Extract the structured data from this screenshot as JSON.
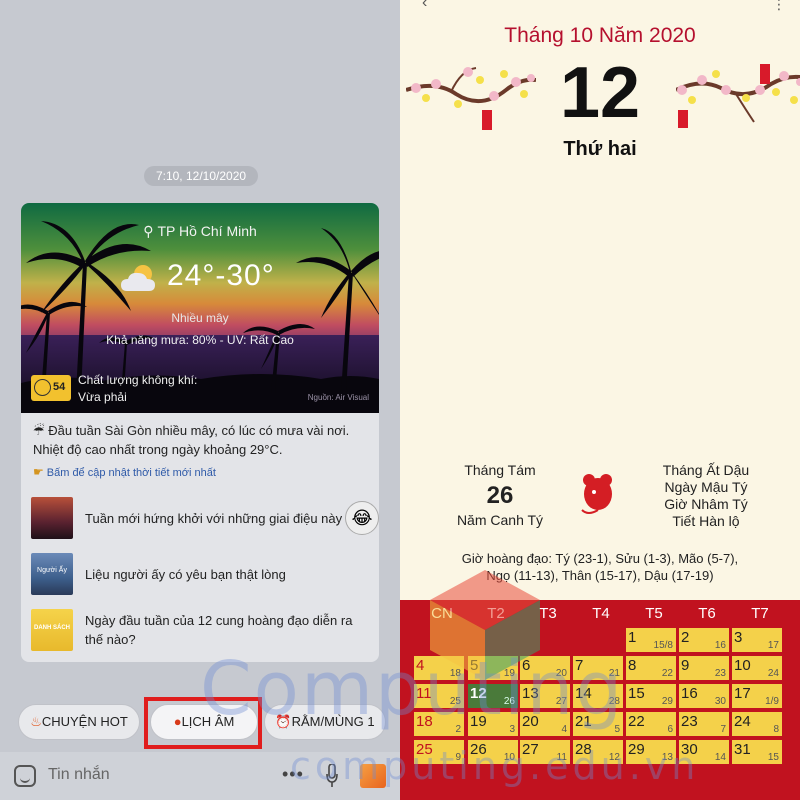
{
  "left": {
    "timestamp": "7:10, 12/10/2020",
    "weather": {
      "location": "TP Hồ Chí Minh",
      "temperature": "24°-30°",
      "description": "Nhiều mây",
      "rain_uv": "Khả năng mưa: 80% - UV: Rất Cao",
      "aqi_value": "54",
      "aqi_label": "Chất lượng không khí:",
      "aqi_status": "Vừa phải",
      "source": "Nguồn: Air Visual"
    },
    "news": "Đầu tuần Sài Gòn nhiều mây, có lúc có mưa vài nơi. Nhiệt độ cao nhất trong ngày khoảng 29°C.",
    "update_link": "Bấm để cập nhật thời tiết mới nhất",
    "items": [
      {
        "title": "Tuần mới hứng khởi với những giai điệu này"
      },
      {
        "title": "Liệu người ấy có yêu bạn thật lòng",
        "thumb_text": "Người Ấy"
      },
      {
        "title": "Ngày đầu tuần của 12 cung hoàng đạo diễn ra thế nào?",
        "thumb_text": "DANH SÁCH"
      }
    ],
    "chips": {
      "hot": "CHUYỆN HOT",
      "lich_am": "LỊCH ÂM",
      "ram": "RẰM/MÙNG 1"
    },
    "message_placeholder": "Tin nhắn",
    "colors": {
      "highlight": "#e01d1d",
      "link": "#2f5aa8"
    }
  },
  "right": {
    "title": "Tháng 10 Năm 2020",
    "day": "12",
    "weekday": "Thứ hai",
    "lunar_month": "Tháng Tám",
    "lunar_day": "26",
    "lunar_year": "Năm Canh Tý",
    "can_chi": [
      "Tháng Ất Dậu",
      "Ngày Mậu Tý",
      "Giờ Nhâm Tý",
      "Tiết Hàn lộ"
    ],
    "gio_hoang_dao_1": "Giờ hoàng đạo: Tý (23-1), Sửu (1-3), Mão (5-7),",
    "gio_hoang_dao_2": "Ngọ (11-13), Thân (15-17), Dậu (17-19)",
    "week_headers": [
      "CN",
      "T2",
      "T3",
      "T4",
      "T5",
      "T6",
      "T7"
    ],
    "calendar": [
      {
        "day": "1",
        "lunar": "15/8"
      },
      {
        "day": "2",
        "lunar": "16"
      },
      {
        "day": "3",
        "lunar": "17"
      },
      {
        "day": "4",
        "lunar": "18"
      },
      {
        "day": "5",
        "lunar": "19"
      },
      {
        "day": "6",
        "lunar": "20"
      },
      {
        "day": "7",
        "lunar": "21"
      },
      {
        "day": "8",
        "lunar": "22"
      },
      {
        "day": "9",
        "lunar": "23"
      },
      {
        "day": "10",
        "lunar": "24"
      },
      {
        "day": "11",
        "lunar": "25"
      },
      {
        "day": "12",
        "lunar": "26"
      },
      {
        "day": "13",
        "lunar": "27"
      },
      {
        "day": "14",
        "lunar": "28"
      },
      {
        "day": "15",
        "lunar": "29"
      },
      {
        "day": "16",
        "lunar": "30"
      },
      {
        "day": "17",
        "lunar": "1/9"
      },
      {
        "day": "18",
        "lunar": "2"
      },
      {
        "day": "19",
        "lunar": "3"
      },
      {
        "day": "20",
        "lunar": "4"
      },
      {
        "day": "21",
        "lunar": "5"
      },
      {
        "day": "22",
        "lunar": "6"
      },
      {
        "day": "23",
        "lunar": "7"
      },
      {
        "day": "24",
        "lunar": "8"
      },
      {
        "day": "25",
        "lunar": "9"
      },
      {
        "day": "26",
        "lunar": "10"
      },
      {
        "day": "27",
        "lunar": "11"
      },
      {
        "day": "28",
        "lunar": "12"
      },
      {
        "day": "29",
        "lunar": "13"
      },
      {
        "day": "30",
        "lunar": "14"
      },
      {
        "day": "31",
        "lunar": "15"
      }
    ],
    "colors": {
      "title": "#b5102e",
      "calendar_bg": "#c1121f",
      "cell": "#f4d14a",
      "today": "#4a7a3a"
    }
  },
  "watermark": {
    "brand": "Computing",
    "domain": "computing.edu.vn"
  }
}
